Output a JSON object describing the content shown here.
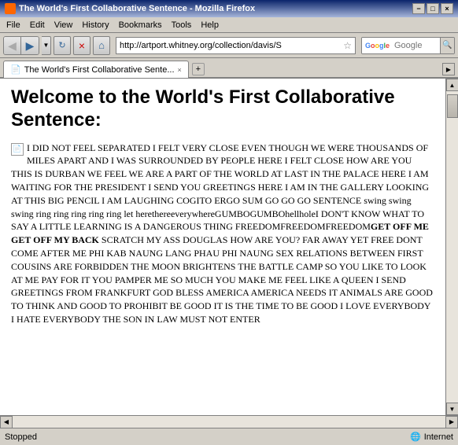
{
  "window": {
    "title": "The World's First Collaborative Sentence - Mozilla Firefox",
    "title_icon": "🦊"
  },
  "title_bar": {
    "controls": {
      "minimize": "−",
      "maximize": "□",
      "close": "×"
    }
  },
  "menu_bar": {
    "items": [
      "File",
      "Edit",
      "View",
      "History",
      "Bookmarks",
      "Tools",
      "Help"
    ]
  },
  "toolbar": {
    "back_label": "◀",
    "forward_label": "▶",
    "refresh_label": "↻",
    "stop_label": "×",
    "home_label": "⌂",
    "address": "http://artport.whitney.org/collection/davis/S",
    "search_placeholder": "Google",
    "dropdown": "▼"
  },
  "tabs": [
    {
      "label": "The World's First Collaborative Sente...",
      "active": true,
      "icon": "📄"
    }
  ],
  "page": {
    "heading": "Welcome to the World's First Collaborative Sentence:",
    "body": "I DID NOT FEEL SEPARATED I FELT VERY CLOSE EVEN THOUGH WE WERE THOUSANDS OF MILES APART AND I WAS SURROUNDED BY PEOPLE HERE I FELT CLOSE HOW ARE YOU THIS IS DURBAN WE FEEL WE ARE A PART OF THE WORLD AT LAST IN THE PALACE HERE I AM WAITING FOR THE PRESIDENT I SEND YOU GREETINGS HERE I AM IN THE GALLERY LOOKING AT THIS BIG PENCIL I AM LAUGHING COGITO ERGO SUM GO GO GO SENTENCE swing swing swing ring ring ring ring ring let herethereeverywhereGUMBOGUMBOhellholeI DON'T KNOW WHAT TO SAY A LITTLE LEARNING IS A DANGEROUS THING FREEDOMFREEDOMFREEDOM",
    "bold_text": "GET OFF ME GET OFF MY BACK",
    "body2": " SCRATCH MY ASS DOUGLAS HOW ARE YOU? FAR AWAY YET FREE DONT COME AFTER ME PHI KAB NAUNG LANG PHAU PHI NAUNG SEX RELATIONS BETWEEN FIRST COUSINS ARE FORBIDDEN THE MOON BRIGHTENS THE BATTLE CAMP SO YOU LIKE TO LOOK AT ME PAY FOR IT YOU PAMPER ME SO MUCH YOU MAKE ME FEEL LIKE A QUEEN I SEND GREETINGS FROM FRANKFURT GOD BLESS AMERICA AMERICA NEEDS IT ANIMALS ARE GOOD TO THINK AND GOOD TO PROHIBIT BE GOOD IT IS THE TIME TO BE GOOD I LOVE EVERYBODY I HATE EVERYBODY THE SON IN LAW MUST NOT ENTER"
  },
  "status_bar": {
    "text": "Stopped",
    "zone": "Internet"
  }
}
